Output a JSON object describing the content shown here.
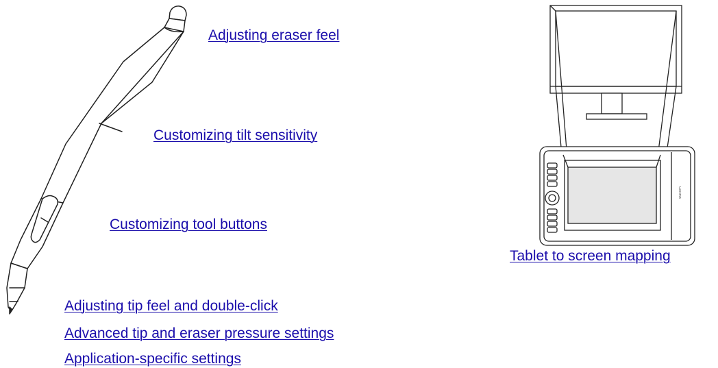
{
  "link_color": "#1a0dab",
  "links": {
    "eraser_feel": "Adjusting eraser feel",
    "tilt_sensitivity": "Customizing tilt sensitivity",
    "tool_buttons": "Customizing tool buttons",
    "tip_feel": "Adjusting tip feel and double-click",
    "advanced_pressure": "Advanced tip and eraser pressure settings",
    "app_specific": "Application-specific settings",
    "tablet_mapping": "Tablet to screen mapping"
  },
  "tablet_logo_text": "wacom"
}
